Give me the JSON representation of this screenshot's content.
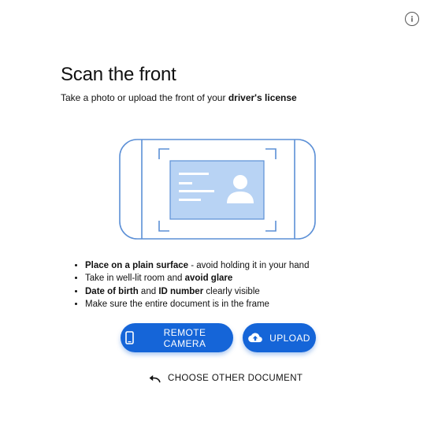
{
  "header": {
    "title": "Scan the front",
    "subtitle_prefix": "Take a photo or upload the front of your ",
    "subtitle_bold": "driver's license",
    "info_icon": "info-icon"
  },
  "tips": [
    {
      "bold": "Place on a plain surface",
      "text": " - avoid holding it in your hand"
    },
    {
      "text_before": "Take in well-lit room and ",
      "bold": "avoid glare"
    },
    {
      "bold_1": "Date of birth",
      "text_mid": " and ",
      "bold_2": "ID number",
      "text_after": " clearly visible"
    },
    {
      "text": "Make sure the entire document is in the frame"
    }
  ],
  "buttons": {
    "remote_camera": {
      "label": "REMOTE CAMERA",
      "icon": "phone-icon"
    },
    "upload": {
      "label": "UPLOAD",
      "icon": "cloud-upload-icon"
    },
    "choose_other": {
      "label": "CHOOSE OTHER DOCUMENT",
      "icon": "undo-arrow-icon"
    }
  },
  "colors": {
    "accent": "#1565d8",
    "illustration_stroke": "#5b8fd6",
    "card_fill": "#b8d3f4"
  }
}
